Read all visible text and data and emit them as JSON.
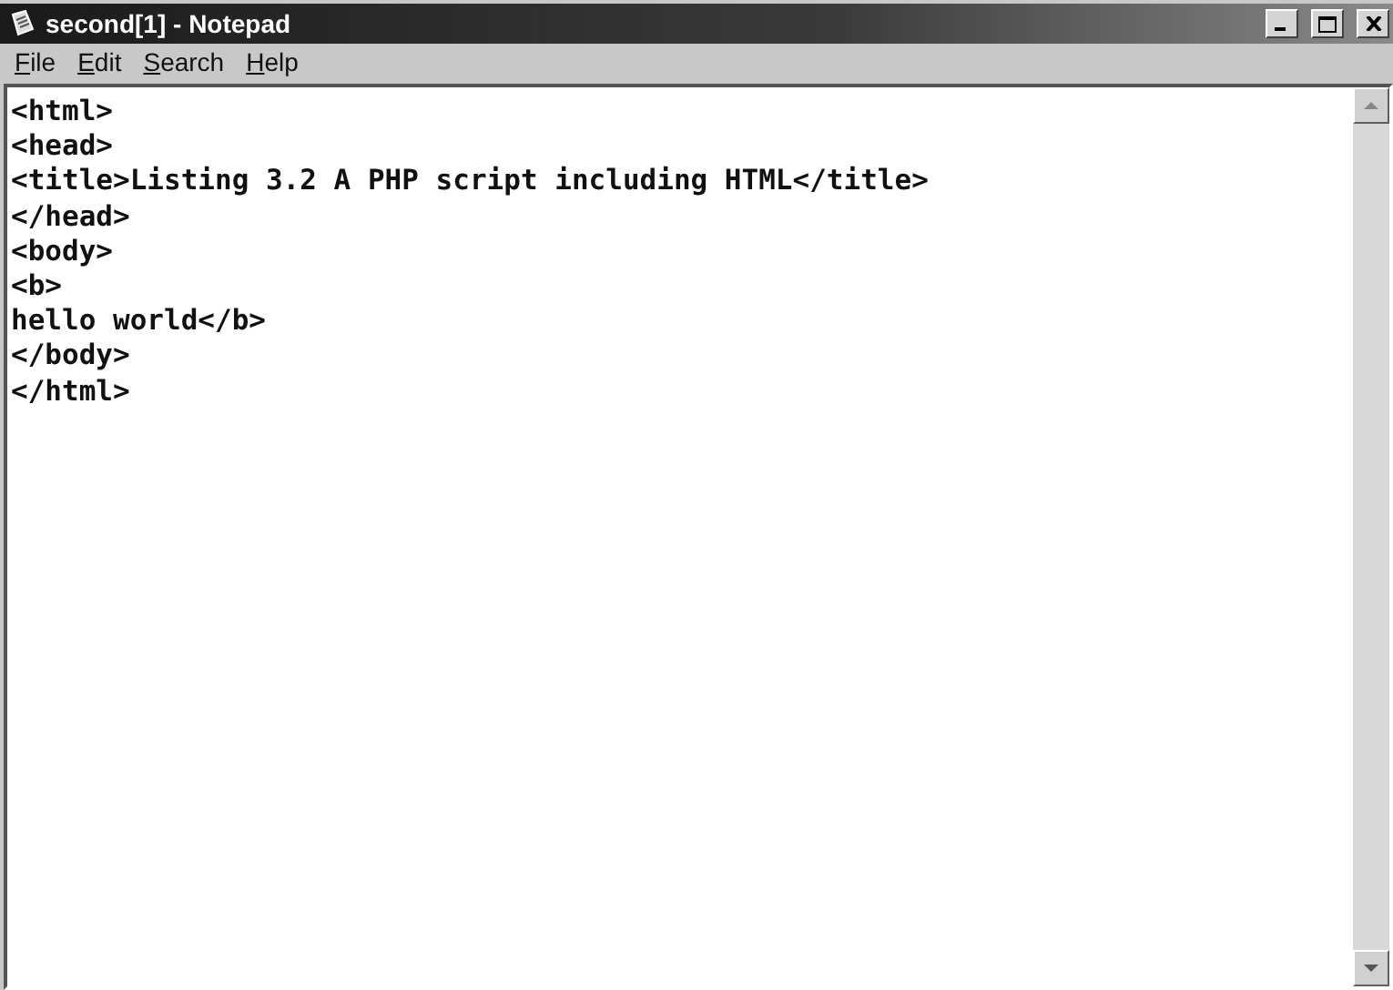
{
  "window": {
    "title": "second[1] - Notepad"
  },
  "menu": [
    "File",
    "Edit",
    "Search",
    "Help"
  ],
  "editor": {
    "lines": [
      "<html>",
      "<head>",
      "<title>Listing 3.2 A PHP script including HTML</title>",
      "</head>",
      "<body>",
      "<b>",
      "hello world</b>",
      "</body>",
      "</html>"
    ]
  }
}
